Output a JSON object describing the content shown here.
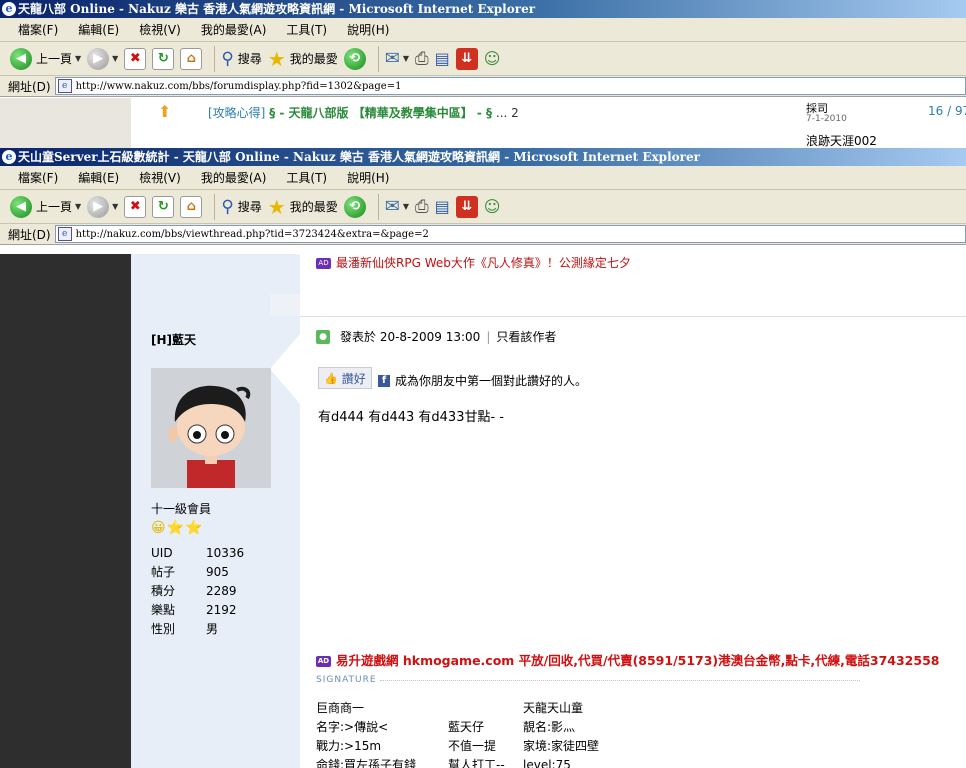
{
  "window1": {
    "title": "天龍八部 Online - Nakuz 樂古 香港人氣網遊攻略資訊網 - Microsoft Internet Explorer",
    "menu": [
      "檔案(F)",
      "編輯(E)",
      "檢視(V)",
      "我的最愛(A)",
      "工具(T)",
      "說明(H)"
    ],
    "toolbar": {
      "back": "上一頁",
      "search": "搜尋",
      "favorites": "我的最愛"
    },
    "address_label": "網址(D)",
    "url": "http://www.nakuz.com/bbs/forumdisplay.php?fid=1302&page=1",
    "thread_row": {
      "tag": "[攻略心得]",
      "title": "§ - 天龍八部版 【精華及教學集中區】 - §",
      "pages": "... 2",
      "author": "採司",
      "date": "7-1-2010",
      "stats": "16 / 97",
      "next_author": "浪跡天涯002"
    }
  },
  "window2": {
    "title": "天山童Server上石級數統計 - 天龍八部 Online - Nakuz 樂古 香港人氣網遊攻略資訊網 - Microsoft Internet Explorer",
    "menu": [
      "檔案(F)",
      "編輯(E)",
      "檢視(V)",
      "我的最愛(A)",
      "工具(T)",
      "說明(H)"
    ],
    "toolbar": {
      "back": "上一頁",
      "search": "搜尋",
      "favorites": "我的最愛"
    },
    "address_label": "網址(D)",
    "url": "http://nakuz.com/bbs/viewthread.php?tid=3723424&extra=&page=2"
  },
  "page": {
    "ad_top": "最潘新仙俠RPG Web大作《凡人修真》！公測緣定七夕",
    "ad_badge": "AD",
    "user": {
      "name": "[H]藍天",
      "rank": "十一級會員",
      "stars": "😀⭐⭐",
      "stats": [
        {
          "k": "UID",
          "v": "10336"
        },
        {
          "k": "帖子",
          "v": "905"
        },
        {
          "k": "積分",
          "v": "2289"
        },
        {
          "k": "樂點",
          "v": "2192"
        },
        {
          "k": "性別",
          "v": "男"
        }
      ]
    },
    "post": {
      "posted_at": "發表於 20-8-2009 13:00",
      "only_author": "只看該作者",
      "like_label": "讚好",
      "like_text": "成為你朋友中第一個對此讚好的人。",
      "message": "有d444 有d443 有d433甘點- -"
    },
    "ad_bottom": "易升遊戲網 hkmogame.com 平放/回收,代買/代賣(8591/5173)港澳台金幣,點卡,代練,電話37432558",
    "signature_label": "SIGNATURE",
    "signature": [
      {
        "c1": "巨商商一",
        "c2": "",
        "c3": "天龍天山童"
      },
      {
        "c1": "名字:>傳說<",
        "c2": "藍天仔",
        "c3": "靚名:影灬"
      },
      {
        "c1": "戰力:>15m",
        "c2": "不值一提",
        "c3": "家境:家徒四壁"
      },
      {
        "c1": "命錢:買左孫子有錢",
        "c2": "幫人打工--",
        "c3": "level:75"
      }
    ]
  }
}
